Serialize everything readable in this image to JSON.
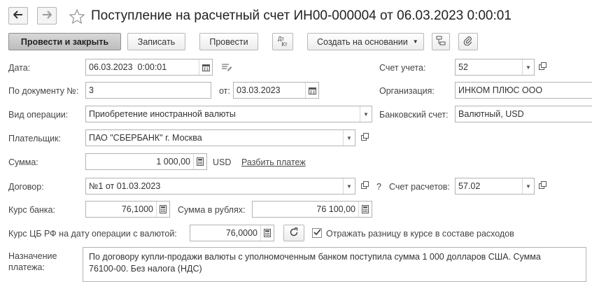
{
  "header": {
    "title": "Поступление на расчетный счет ИН00-000004 от 06.03.2023 0:00:01",
    "back_icon": "arrow-left-icon",
    "forward_icon": "arrow-right-icon",
    "favorite_icon": "star-icon"
  },
  "toolbar": {
    "post_close": "Провести и закрыть",
    "save": "Записать",
    "post": "Провести",
    "dt_kt_icon": "dt-kt-icon",
    "dt_label": "Дт",
    "kt_label": "Кт",
    "create_based": "Создать на основании",
    "structure_icon": "document-structure-icon",
    "attach_icon": "paperclip-icon"
  },
  "form": {
    "date_label": "Дата:",
    "date_value": "06.03.2023  0:00:01",
    "doc_num_label": "По документу №:",
    "doc_num_value": "3",
    "from_label": "от:",
    "from_value": "03.03.2023",
    "op_type_label": "Вид операции:",
    "op_type_value": "Приобретение иностранной валюты",
    "payer_label": "Плательщик:",
    "payer_value": "ПАО \"СБЕРБАНК\" г. Москва",
    "amount_label": "Сумма:",
    "amount_value": "1 000,00",
    "currency": "USD",
    "split_payment": "Разбить платеж",
    "contract_label": "Договор:",
    "contract_value": "№1 от 01.03.2023",
    "question": "?",
    "bank_rate_label": "Курс банка:",
    "bank_rate_value": "76,1000",
    "rub_amount_label": "Сумма в рублях:",
    "rub_amount_value": "76 100,00",
    "cb_rate_label": "Курс ЦБ РФ на дату операции с валютой:",
    "cb_rate_value": "76,0000",
    "reflect_diff_label": "Отражать разницу в курсе в составе расходов",
    "reflect_diff_checked": true,
    "purpose_label_1": "Назначение",
    "purpose_label_2": "платежа:",
    "purpose_line_1": "По договору купли-продажи валюты с уполномоченным банком поступила сумма 1 000 долларов США. Сумма",
    "purpose_line_2": "76100-00. Без налога (НДС)"
  },
  "right_panel": {
    "account_label": "Счет учета:",
    "account_value": "52",
    "org_label": "Организация:",
    "org_value": "ИНКОМ ПЛЮС ООО",
    "bank_account_label": "Банковский счет:",
    "bank_account_value": "Валютный, USD",
    "settlement_label": "Счет расчетов:",
    "settlement_value": "57.02"
  }
}
